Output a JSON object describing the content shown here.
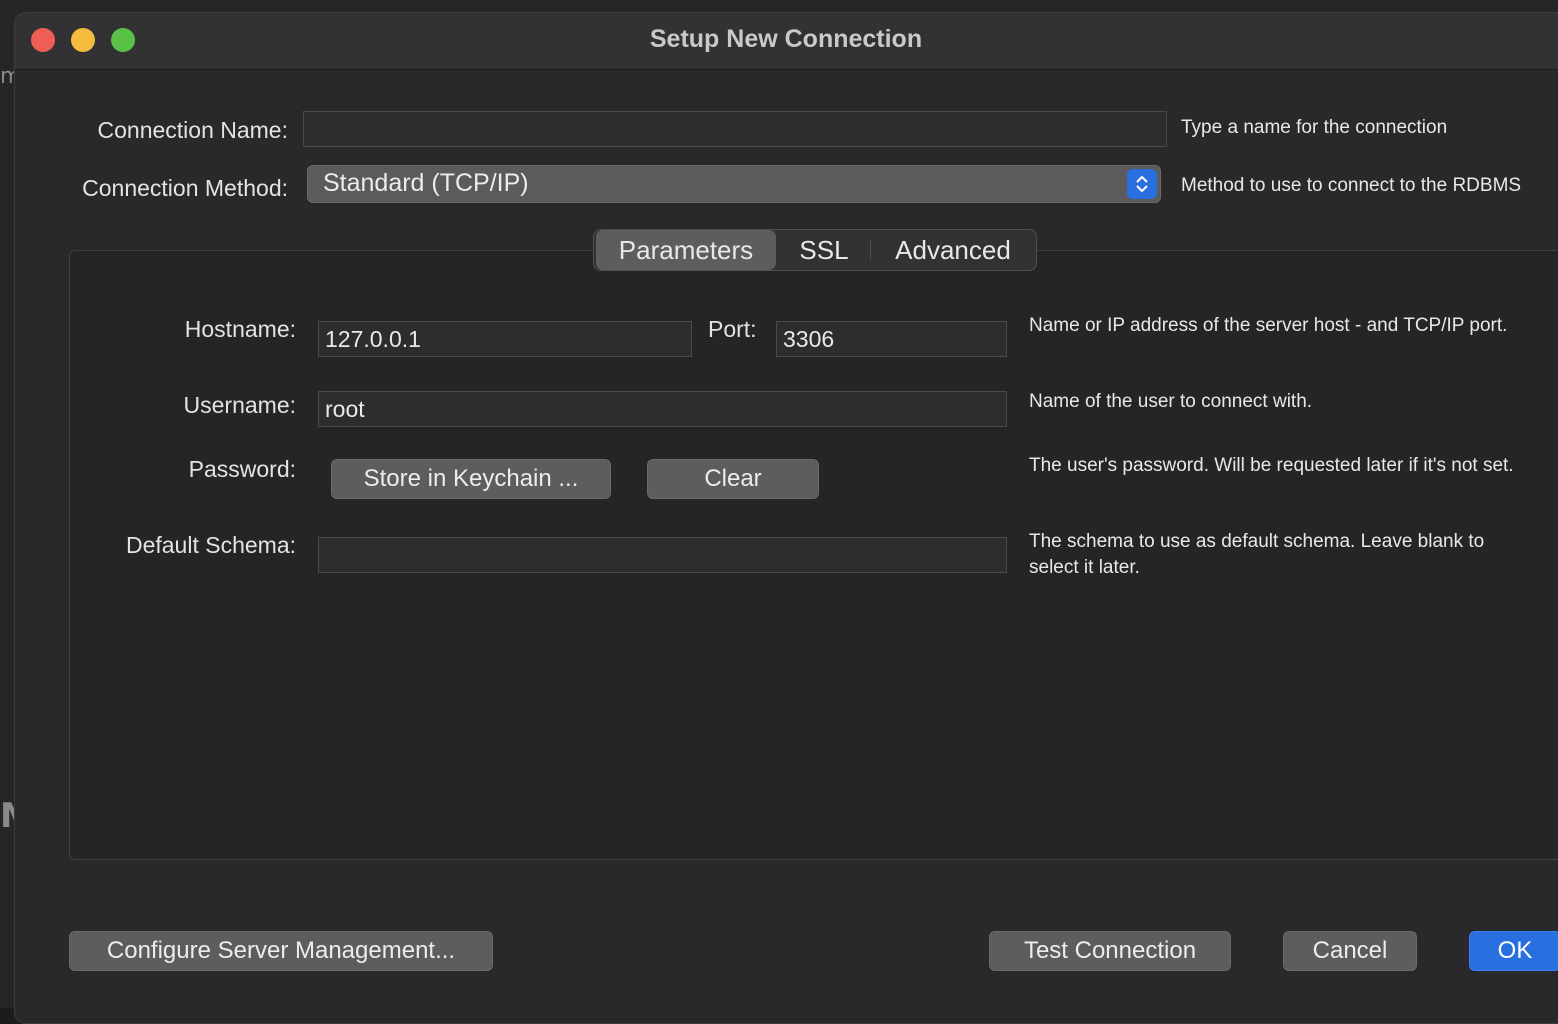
{
  "window": {
    "title": "Setup New Connection",
    "background_text": [
      "m",
      "M"
    ]
  },
  "connection": {
    "name_label": "Connection Name:",
    "name_value": "",
    "name_hint": "Type a name for the connection",
    "method_label": "Connection Method:",
    "method_value": "Standard (TCP/IP)",
    "method_hint": "Method to use to connect to the RDBMS"
  },
  "tabs": [
    {
      "label": "Parameters",
      "active": true
    },
    {
      "label": "SSL",
      "active": false
    },
    {
      "label": "Advanced",
      "active": false
    }
  ],
  "parameters": {
    "hostname_label": "Hostname:",
    "hostname_value": "127.0.0.1",
    "port_label": "Port:",
    "port_value": "3306",
    "hostname_hint": "Name or IP address of the server host - and TCP/IP port.",
    "username_label": "Username:",
    "username_value": "root",
    "username_hint": "Name of the user to connect with.",
    "password_label": "Password:",
    "store_keychain_label": "Store in Keychain ...",
    "clear_label": "Clear",
    "password_hint": "The user's password. Will be requested later if it's not set.",
    "schema_label": "Default Schema:",
    "schema_value": "",
    "schema_hint": "The schema to use as default schema. Leave blank to select it later."
  },
  "footer": {
    "configure_label": "Configure Server Management...",
    "test_label": "Test Connection",
    "cancel_label": "Cancel",
    "ok_label": "OK"
  },
  "colors": {
    "accent": "#2a6fe0",
    "close": "#ee5e56",
    "minimize": "#f5bd3f",
    "maximize": "#5ac146"
  }
}
